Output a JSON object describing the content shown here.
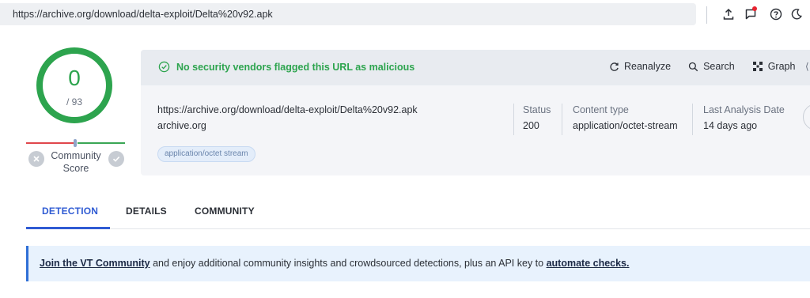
{
  "address_bar": {
    "url": "https://archive.org/download/delta-exploit/Delta%20v92.apk",
    "icons": [
      "upload-icon",
      "notification-icon",
      "help-icon",
      "dark-mode-icon"
    ],
    "notification_dot_color": "#e8232f"
  },
  "score": {
    "detections": "0",
    "total": "/ 93",
    "ring_color": "#2da44e",
    "community_label": "Community Score",
    "community_label_line1": "Community",
    "community_label_line2": "Score"
  },
  "verdict": {
    "text": "No security vendors flagged this URL as malicious",
    "color": "#2da44e"
  },
  "actions": [
    {
      "label": "Reanalyze",
      "icon": "refresh-icon"
    },
    {
      "label": "Search",
      "icon": "search-icon"
    },
    {
      "label": "Graph",
      "icon": "graph-icon"
    }
  ],
  "details": {
    "url": "https://archive.org/download/delta-exploit/Delta%20v92.apk",
    "domain": "archive.org",
    "tag": "application/octet stream",
    "status_label": "Status",
    "status_value": "200",
    "content_type_label": "Content type",
    "content_type_value": "application/octet-stream",
    "last_analysis_label": "Last Analysis Date",
    "last_analysis_value": "14 days ago"
  },
  "tabs": [
    {
      "label": "DETECTION",
      "active": true
    },
    {
      "label": "DETAILS",
      "active": false
    },
    {
      "label": "COMMUNITY",
      "active": false
    }
  ],
  "banner": {
    "link1": "Join the VT Community",
    "middle": " and enjoy additional community insights and crowdsourced detections, plus an API key to ",
    "link2": "automate checks."
  },
  "colors": {
    "accent_blue": "#2f5bd3",
    "safe_green": "#2da44e",
    "banner_bg": "#e8f2fd"
  }
}
